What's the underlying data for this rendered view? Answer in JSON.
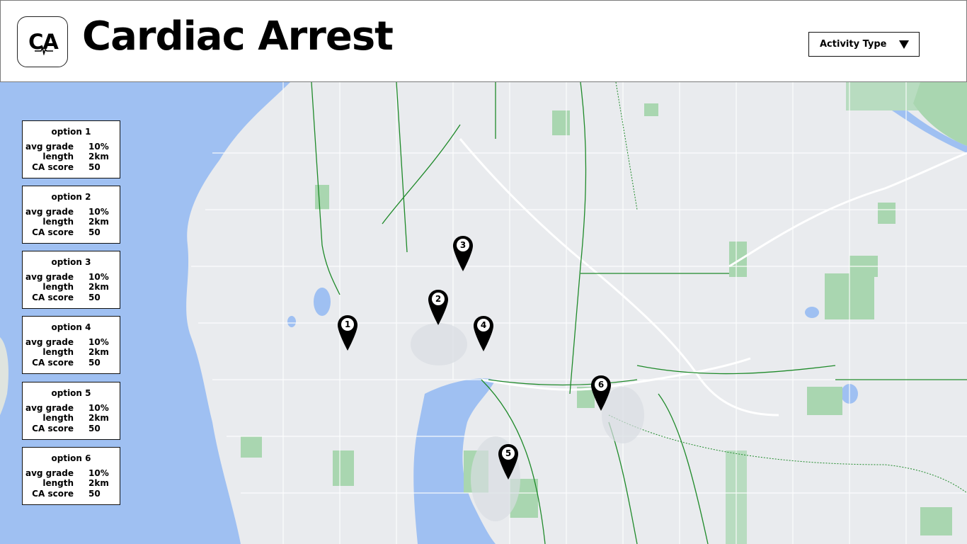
{
  "app": {
    "logo_text": "CA",
    "title": "Cardiac Arrest"
  },
  "controls": {
    "activity_dropdown": {
      "selected": "Activity Type",
      "icon": "caret-down-icon"
    }
  },
  "options": [
    {
      "title": "option 1",
      "avg_grade_label": "avg grade",
      "avg_grade": "10%",
      "length_label": "length",
      "length": "2km",
      "score_label": "CA score",
      "score": "50"
    },
    {
      "title": "option 2",
      "avg_grade_label": "avg grade",
      "avg_grade": "10%",
      "length_label": "length",
      "length": "2km",
      "score_label": "CA score",
      "score": "50"
    },
    {
      "title": "option 3",
      "avg_grade_label": "avg grade",
      "avg_grade": "10%",
      "length_label": "length",
      "length": "2km",
      "score_label": "CA score",
      "score": "50"
    },
    {
      "title": "option 4",
      "avg_grade_label": "avg grade",
      "avg_grade": "10%",
      "length_label": "length",
      "length": "2km",
      "score_label": "CA score",
      "score": "50"
    },
    {
      "title": "option 5",
      "avg_grade_label": "avg grade",
      "avg_grade": "10%",
      "length_label": "length",
      "length": "2km",
      "score_label": "CA score",
      "score": "50"
    },
    {
      "title": "option 6",
      "avg_grade_label": "avg grade",
      "avg_grade": "10%",
      "length_label": "length",
      "length": "2km",
      "score_label": "CA score",
      "score": "50"
    }
  ],
  "map": {
    "pins": [
      {
        "label": "1"
      },
      {
        "label": "2"
      },
      {
        "label": "3"
      },
      {
        "label": "4"
      },
      {
        "label": "5"
      },
      {
        "label": "6"
      }
    ],
    "colors": {
      "water": "#9fc0f2",
      "land": "#e9ebee",
      "park": "#a9d6b0",
      "trail": "#1f8a2a",
      "road": "#ffffff"
    }
  }
}
